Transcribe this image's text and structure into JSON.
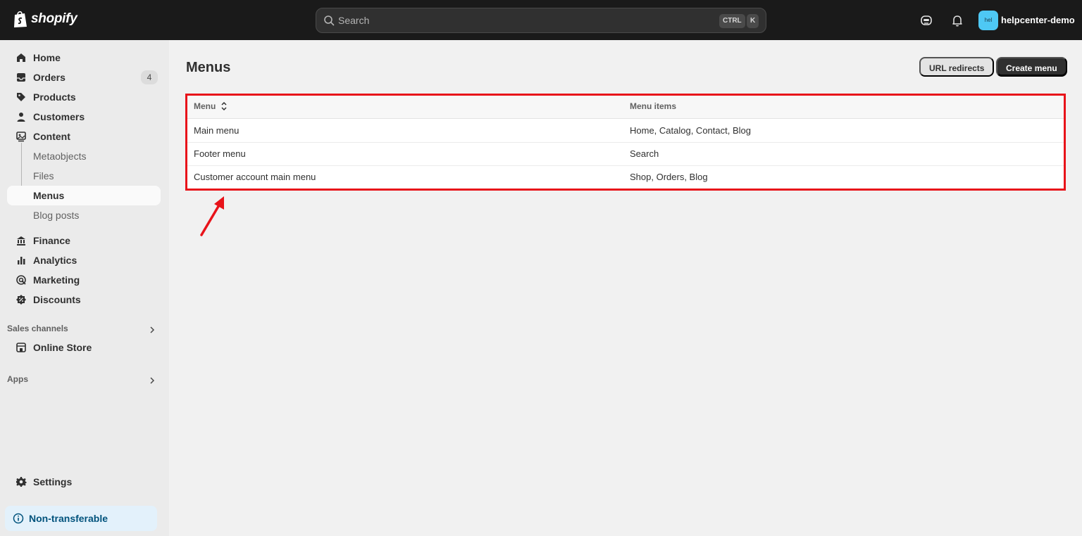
{
  "topbar": {
    "brand": "shopify",
    "search_placeholder": "Search",
    "shortcut_ctrl": "CTRL",
    "shortcut_key": "K",
    "shop_avatar": "hel",
    "shop_name": "helpcenter-demo",
    "icons": [
      "sidekick-icon",
      "bell-icon"
    ]
  },
  "sidebar": {
    "items": [
      {
        "label": "Home",
        "icon": "home-icon"
      },
      {
        "label": "Orders",
        "icon": "inbox-icon",
        "badge": "4"
      },
      {
        "label": "Products",
        "icon": "tag-icon"
      },
      {
        "label": "Customers",
        "icon": "person-icon"
      },
      {
        "label": "Content",
        "icon": "content-icon"
      }
    ],
    "content_sub": [
      {
        "label": "Metaobjects"
      },
      {
        "label": "Files"
      },
      {
        "label": "Menus",
        "active": true
      },
      {
        "label": "Blog posts"
      }
    ],
    "items2": [
      {
        "label": "Finance",
        "icon": "bank-icon"
      },
      {
        "label": "Analytics",
        "icon": "bar-chart-icon"
      },
      {
        "label": "Marketing",
        "icon": "target-icon"
      },
      {
        "label": "Discounts",
        "icon": "discount-icon"
      }
    ],
    "sales_channels_title": "Sales channels",
    "online_store": "Online Store",
    "apps_title": "Apps",
    "settings": "Settings",
    "non_transferable": "Non-transferable"
  },
  "main": {
    "title": "Menus",
    "url_redirects_button": "URL redirects",
    "create_menu_button": "Create menu",
    "table": {
      "headers": {
        "menu": "Menu",
        "items": "Menu items"
      },
      "rows": [
        {
          "name": "Main menu",
          "items": "Home, Catalog, Contact, Blog"
        },
        {
          "name": "Footer menu",
          "items": "Search"
        },
        {
          "name": "Customer account main menu",
          "items": "Shop, Orders, Blog"
        }
      ]
    }
  },
  "colors": {
    "topbar": "#1a1a1a",
    "highlight": "#e8131a",
    "avatar": "#4ec8f4",
    "primary_button": "#303030"
  }
}
